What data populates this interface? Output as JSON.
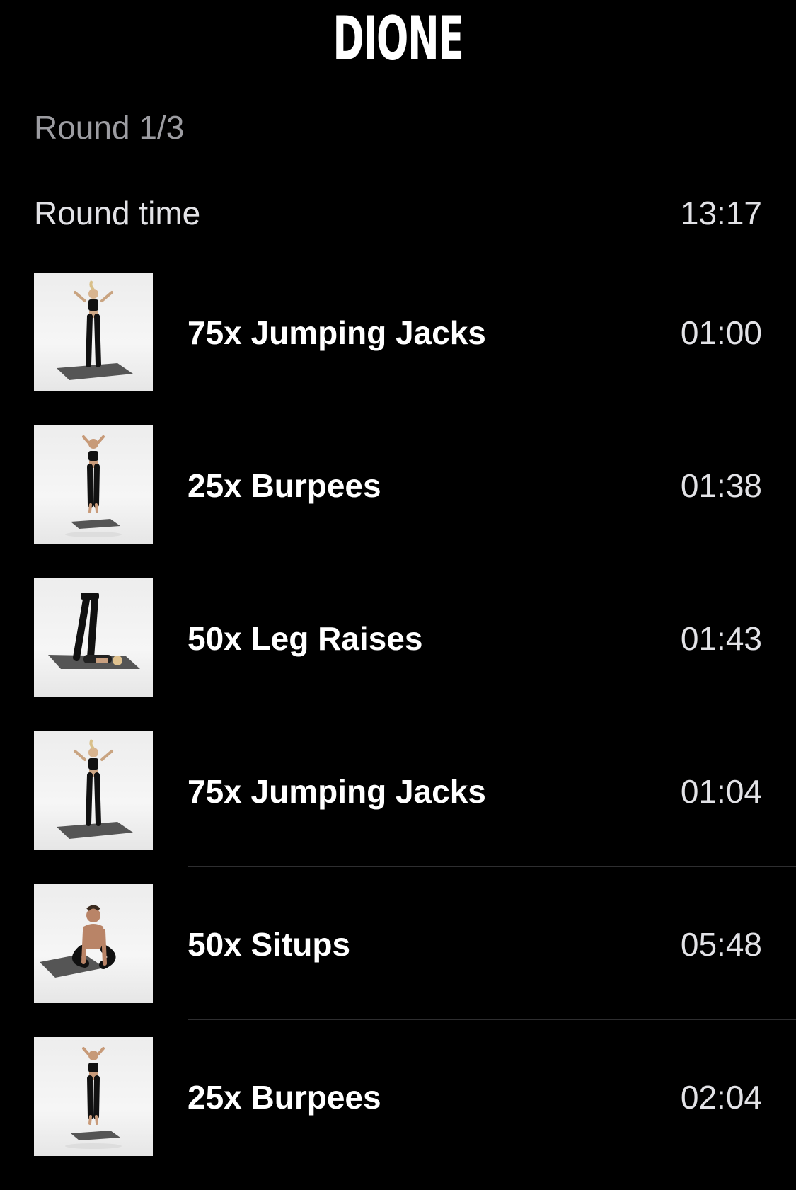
{
  "header": {
    "title": "DIONE"
  },
  "round": {
    "label": "Round 1/3",
    "time_label": "Round time",
    "time_value": "13:17"
  },
  "exercises": [
    {
      "name": "75x Jumping Jacks",
      "time": "01:00",
      "thumbnail": "jumping-jacks-figure"
    },
    {
      "name": "25x Burpees",
      "time": "01:38",
      "thumbnail": "burpee-jump-figure"
    },
    {
      "name": "50x Leg Raises",
      "time": "01:43",
      "thumbnail": "leg-raise-figure"
    },
    {
      "name": "75x Jumping Jacks",
      "time": "01:04",
      "thumbnail": "jumping-jacks-figure"
    },
    {
      "name": "50x Situps",
      "time": "05:48",
      "thumbnail": "situp-figure"
    },
    {
      "name": "25x Burpees",
      "time": "02:04",
      "thumbnail": "burpee-jump-figure"
    }
  ],
  "colors": {
    "background": "#000000",
    "primary_text": "#ffffff",
    "secondary_text": "#9d9da2",
    "time_text": "#e2e2e6",
    "divider": "#2e2e30",
    "thumbnail_bg": "#f0f0f0"
  }
}
